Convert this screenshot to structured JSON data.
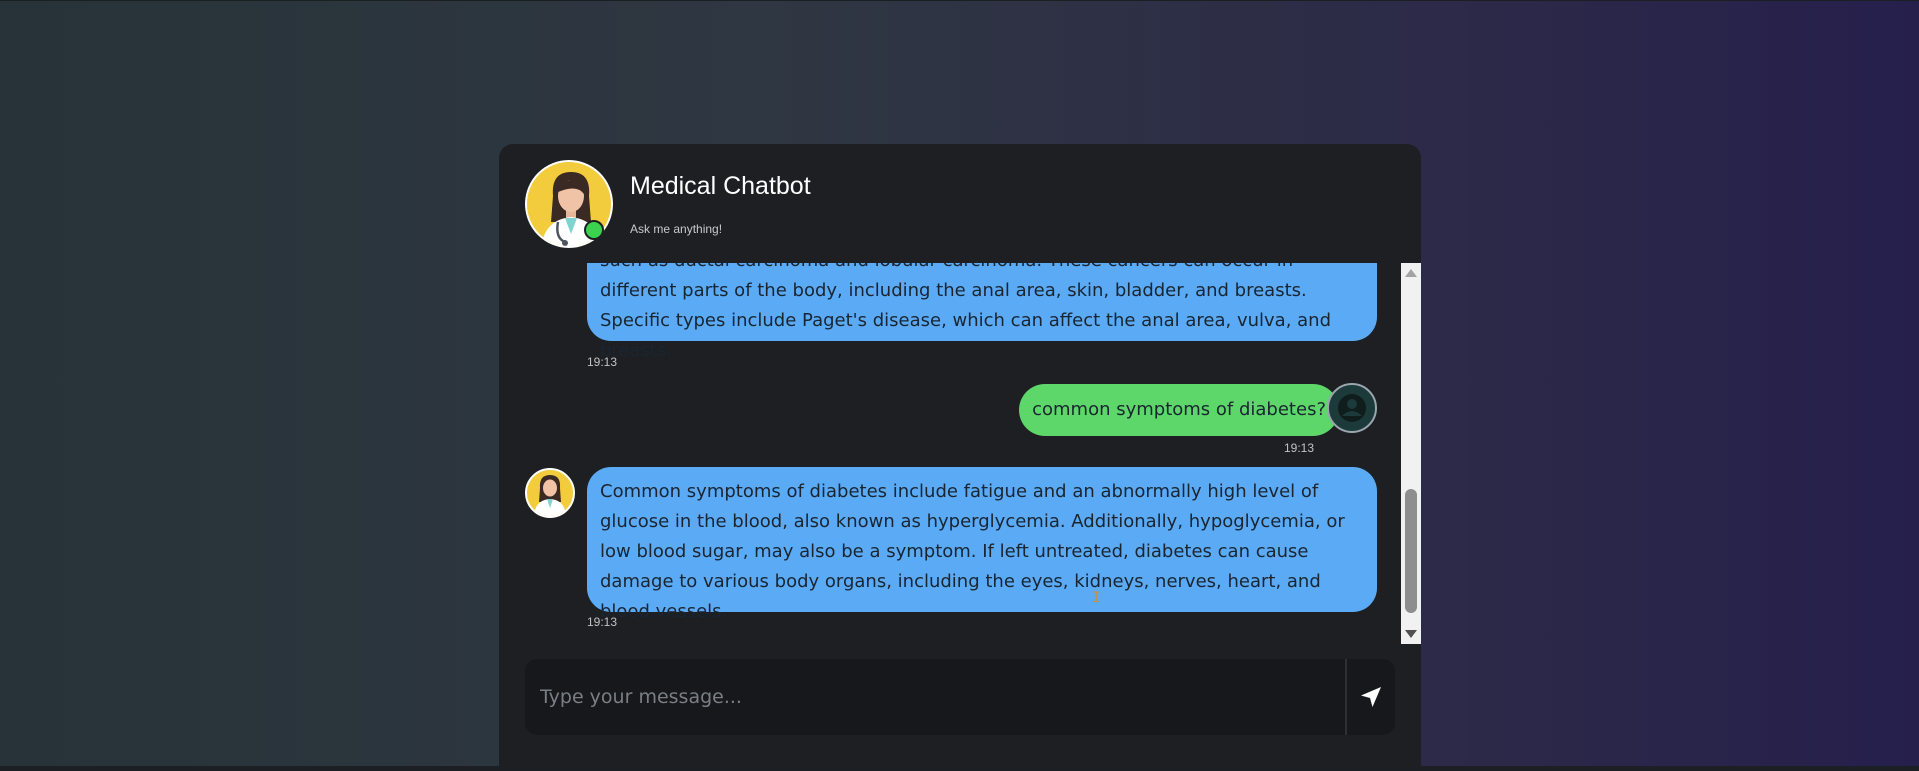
{
  "header": {
    "title": "Medical Chatbot",
    "subtitle": "Ask me anything!"
  },
  "messages": [
    {
      "sender": "bot",
      "text": "such as ductal carcinoma and lobular carcinoma. These cancers can occur in different parts of the body, including the anal area, skin, bladder, and breasts. Specific types include Paget's disease, which can affect the anal area, vulva, and breasts.",
      "time": "19:13"
    },
    {
      "sender": "user",
      "text": "common symptoms of diabetes?",
      "time": "19:13"
    },
    {
      "sender": "bot",
      "text": "Common symptoms of diabetes include fatigue and an abnormally high level of glucose in the blood, also known as hyperglycemia. Additionally, hypoglycemia, or low blood sugar, may also be a symptom. If left untreated, diabetes can cause damage to various body organs, including the eyes, kidneys, nerves, heart, and blood vessels.",
      "time": "19:13"
    }
  ],
  "composer": {
    "placeholder": "Type your message..."
  },
  "icons": {
    "send": "send-icon",
    "bot_avatar": "doctor-avatar",
    "user_avatar": "user-avatar"
  },
  "colors": {
    "bot_bubble": "#5aaaf6",
    "user_bubble": "#5dd66a",
    "online": "#3ad24e",
    "card": "#1d1f23"
  }
}
